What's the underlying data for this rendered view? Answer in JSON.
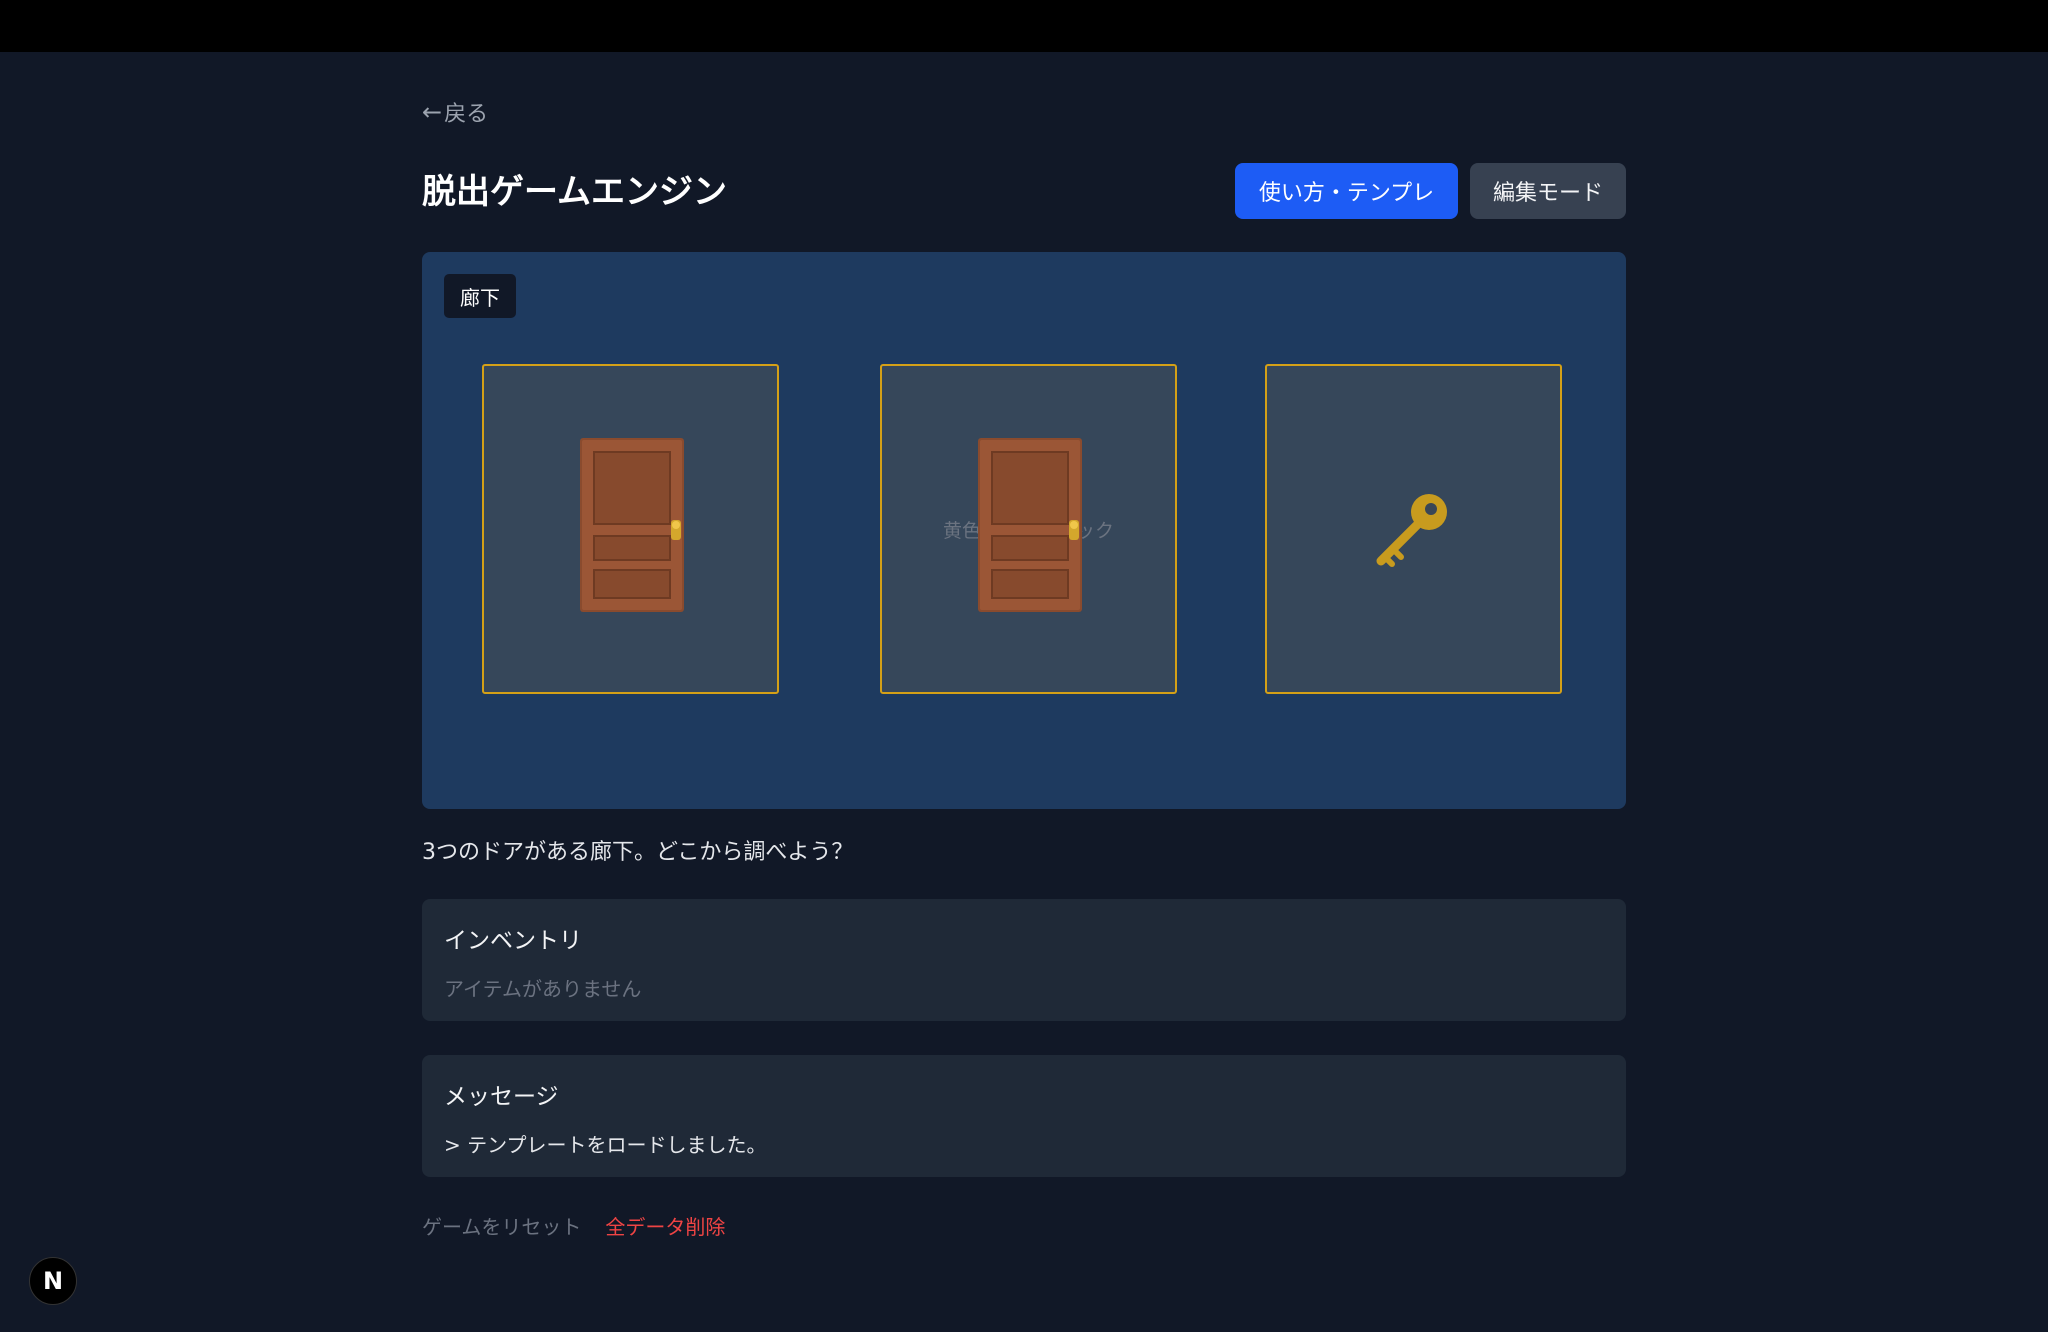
{
  "nav": {
    "back_arrow": "←",
    "back_label": "戻る"
  },
  "header": {
    "title": "脱出ゲームエンジン",
    "help_button": "使い方・テンプレ",
    "edit_button": "編集モード"
  },
  "scene": {
    "room_name": "廊下",
    "hint": "黄色い枠をクリック",
    "hotspots": [
      {
        "icon": "door-icon"
      },
      {
        "icon": "door-icon"
      },
      {
        "icon": "key-icon"
      }
    ],
    "description": "3つのドアがある廊下。どこから調べよう？"
  },
  "inventory": {
    "title": "インベントリ",
    "empty_text": "アイテムがありません"
  },
  "messages": {
    "title": "メッセージ",
    "lines": [
      "> テンプレートをロードしました。"
    ]
  },
  "footer": {
    "reset_label": "ゲームをリセット",
    "delete_label": "全データ削除"
  },
  "dev_badge": {
    "letter": "N"
  },
  "colors": {
    "background": "#111827",
    "scene_bg": "#1e3a5f",
    "hotspot_border": "#d4a017",
    "primary": "#1d5cf5",
    "danger": "#ef4444"
  }
}
